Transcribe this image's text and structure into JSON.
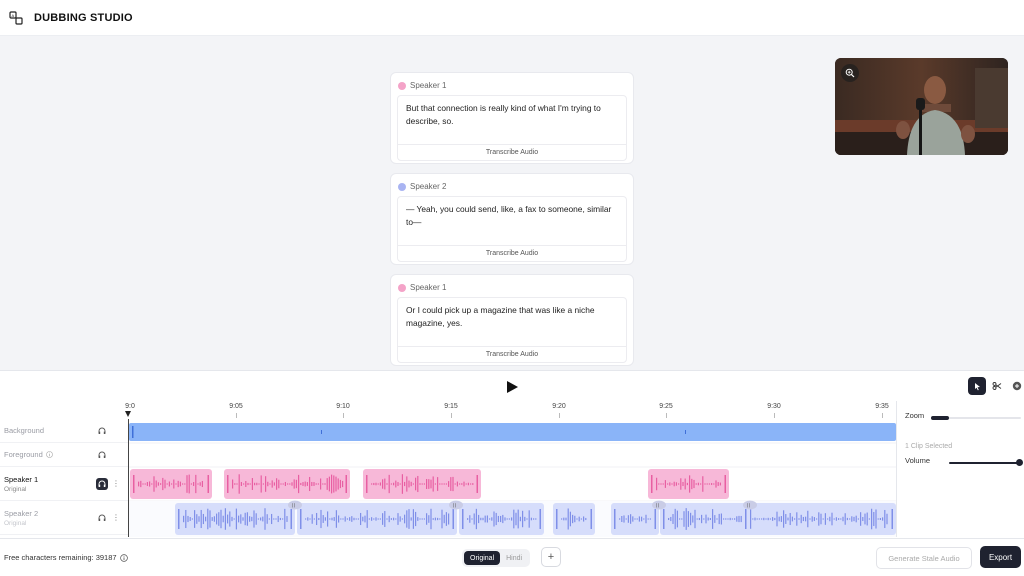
{
  "header": {
    "title": "DUBBING STUDIO"
  },
  "segments": [
    {
      "speaker": "Speaker 1",
      "color": "#f4a3c8",
      "text": "But that connection is really kind of what I'm trying to describe, so.",
      "action": "Transcribe Audio"
    },
    {
      "speaker": "Speaker 2",
      "color": "#a9b4f2",
      "text": "— Yeah, you could send, like, a fax to someone, similar to—",
      "action": "Transcribe Audio"
    },
    {
      "speaker": "Speaker 1",
      "color": "#f4a3c8",
      "text": "Or I could pick up a magazine that was like a niche magazine, yes.",
      "action": "Transcribe Audio"
    }
  ],
  "timeline": {
    "ticks": [
      "9:0",
      "9:05",
      "9:10",
      "9:15",
      "9:20",
      "9:25",
      "9:30",
      "9:35"
    ],
    "tracks": {
      "background": {
        "name": "Background"
      },
      "foreground": {
        "name": "Foreground"
      },
      "speaker1": {
        "name": "Speaker 1",
        "sub": "Original"
      },
      "speaker2": {
        "name": "Speaker 2",
        "sub": "Original"
      }
    },
    "colors": {
      "background": "#8ab4f8",
      "speaker1": "#f7b8d8",
      "speaker2": "#d6ddfb"
    }
  },
  "right_panel": {
    "zoom_label": "Zoom",
    "selected": "1 Clip Selected",
    "volume_label": "Volume"
  },
  "footer": {
    "free_chars": "Free characters remaining: 39187",
    "lang_original": "Original",
    "lang_hindi": "Hindi",
    "add": "+",
    "generate": "Generate Stale Audio",
    "export": "Export"
  }
}
